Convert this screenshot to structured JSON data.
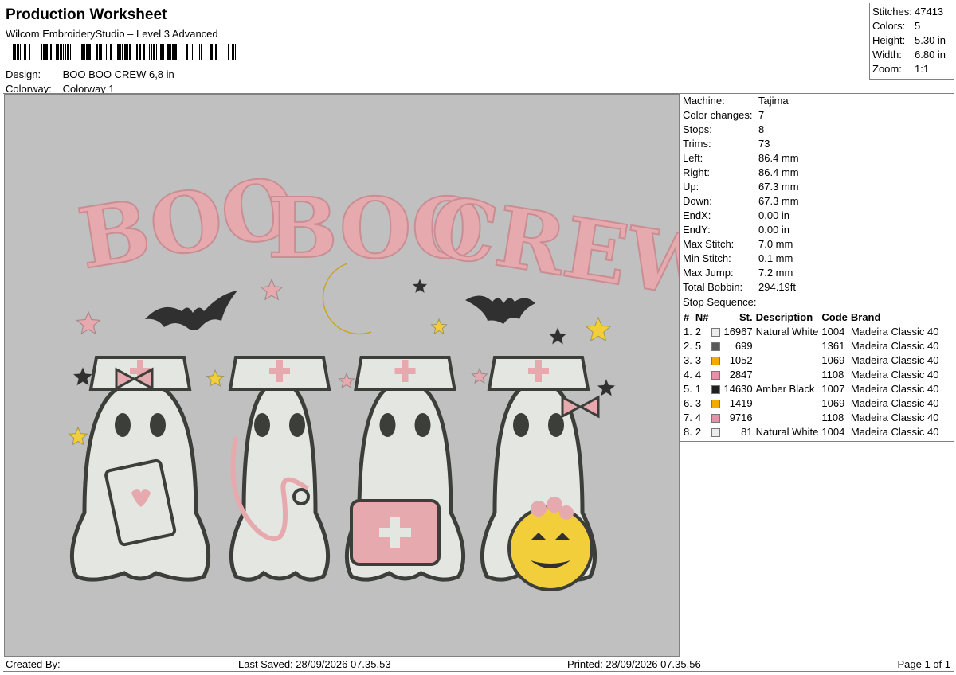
{
  "header": {
    "title": "Production Worksheet",
    "subtitle": "Wilcom EmbroideryStudio – Level 3 Advanced",
    "design_label": "Design:",
    "design_value": "BOO BOO CREW 6,8 in",
    "colorway_label": "Colorway:",
    "colorway_value": "Colorway 1"
  },
  "summary": [
    {
      "label": "Stitches:",
      "value": "47413"
    },
    {
      "label": "Colors:",
      "value": "5"
    },
    {
      "label": "Height:",
      "value": "5.30 in"
    },
    {
      "label": "Width:",
      "value": "6.80 in"
    },
    {
      "label": "Zoom:",
      "value": "1:1"
    }
  ],
  "machine_info": [
    {
      "label": "Machine:",
      "value": "Tajima"
    },
    {
      "label": "Color changes:",
      "value": "7"
    },
    {
      "label": "Stops:",
      "value": "8"
    },
    {
      "label": "Trims:",
      "value": "73"
    },
    {
      "label": "Left:",
      "value": "86.4 mm"
    },
    {
      "label": "Right:",
      "value": "86.4 mm"
    },
    {
      "label": "Up:",
      "value": "67.3 mm"
    },
    {
      "label": "Down:",
      "value": "67.3 mm"
    },
    {
      "label": "EndX:",
      "value": "0.00 in"
    },
    {
      "label": "EndY:",
      "value": "0.00 in"
    },
    {
      "label": "Max Stitch:",
      "value": "7.0 mm"
    },
    {
      "label": "Min Stitch:",
      "value": "0.1 mm"
    },
    {
      "label": "Max Jump:",
      "value": "7.2 mm"
    },
    {
      "label": "Total Bobbin:",
      "value": "294.19ft"
    }
  ],
  "stop_sequence": {
    "title": "Stop Sequence:",
    "headers": [
      "#",
      "N#",
      "St.",
      "Description",
      "Code",
      "Brand"
    ],
    "rows": [
      {
        "num": "1.",
        "n": "2",
        "color": "#ececec",
        "st": "16967",
        "desc": "Natural White",
        "code": "1004",
        "brand": "Madeira Classic 40"
      },
      {
        "num": "2.",
        "n": "5",
        "color": "#5a5a5a",
        "st": "699",
        "desc": "",
        "code": "1361",
        "brand": "Madeira Classic 40"
      },
      {
        "num": "3.",
        "n": "3",
        "color": "#f5a800",
        "st": "1052",
        "desc": "",
        "code": "1069",
        "brand": "Madeira Classic 40"
      },
      {
        "num": "4.",
        "n": "4",
        "color": "#e890a8",
        "st": "2847",
        "desc": "",
        "code": "1108",
        "brand": "Madeira Classic 40"
      },
      {
        "num": "5.",
        "n": "1",
        "color": "#202020",
        "st": "14630",
        "desc": "Amber Black",
        "code": "1007",
        "brand": "Madeira Classic 40"
      },
      {
        "num": "6.",
        "n": "3",
        "color": "#f5a800",
        "st": "1419",
        "desc": "",
        "code": "1069",
        "brand": "Madeira Classic 40"
      },
      {
        "num": "7.",
        "n": "4",
        "color": "#e890a8",
        "st": "9716",
        "desc": "",
        "code": "1108",
        "brand": "Madeira Classic 40"
      },
      {
        "num": "8.",
        "n": "2",
        "color": "#ececec",
        "st": "81",
        "desc": "Natural White",
        "code": "1004",
        "brand": "Madeira Classic 40"
      }
    ]
  },
  "design_preview": {
    "word_1": "BOO",
    "word_2": "BOO",
    "word_3": "CREW",
    "colors": {
      "pink": "#e6a9ad",
      "ghost": "#e3e6e1",
      "outline": "#3c3e3a",
      "yellow": "#f2cf3a",
      "dark": "#2f302f",
      "background": "#c0c0c0"
    }
  },
  "footer": {
    "created_by": "Created By:",
    "last_saved": "Last Saved: 28/09/2026 07.35.53",
    "printed": "Printed: 28/09/2026 07.35.56",
    "page": "Page 1 of 1"
  }
}
